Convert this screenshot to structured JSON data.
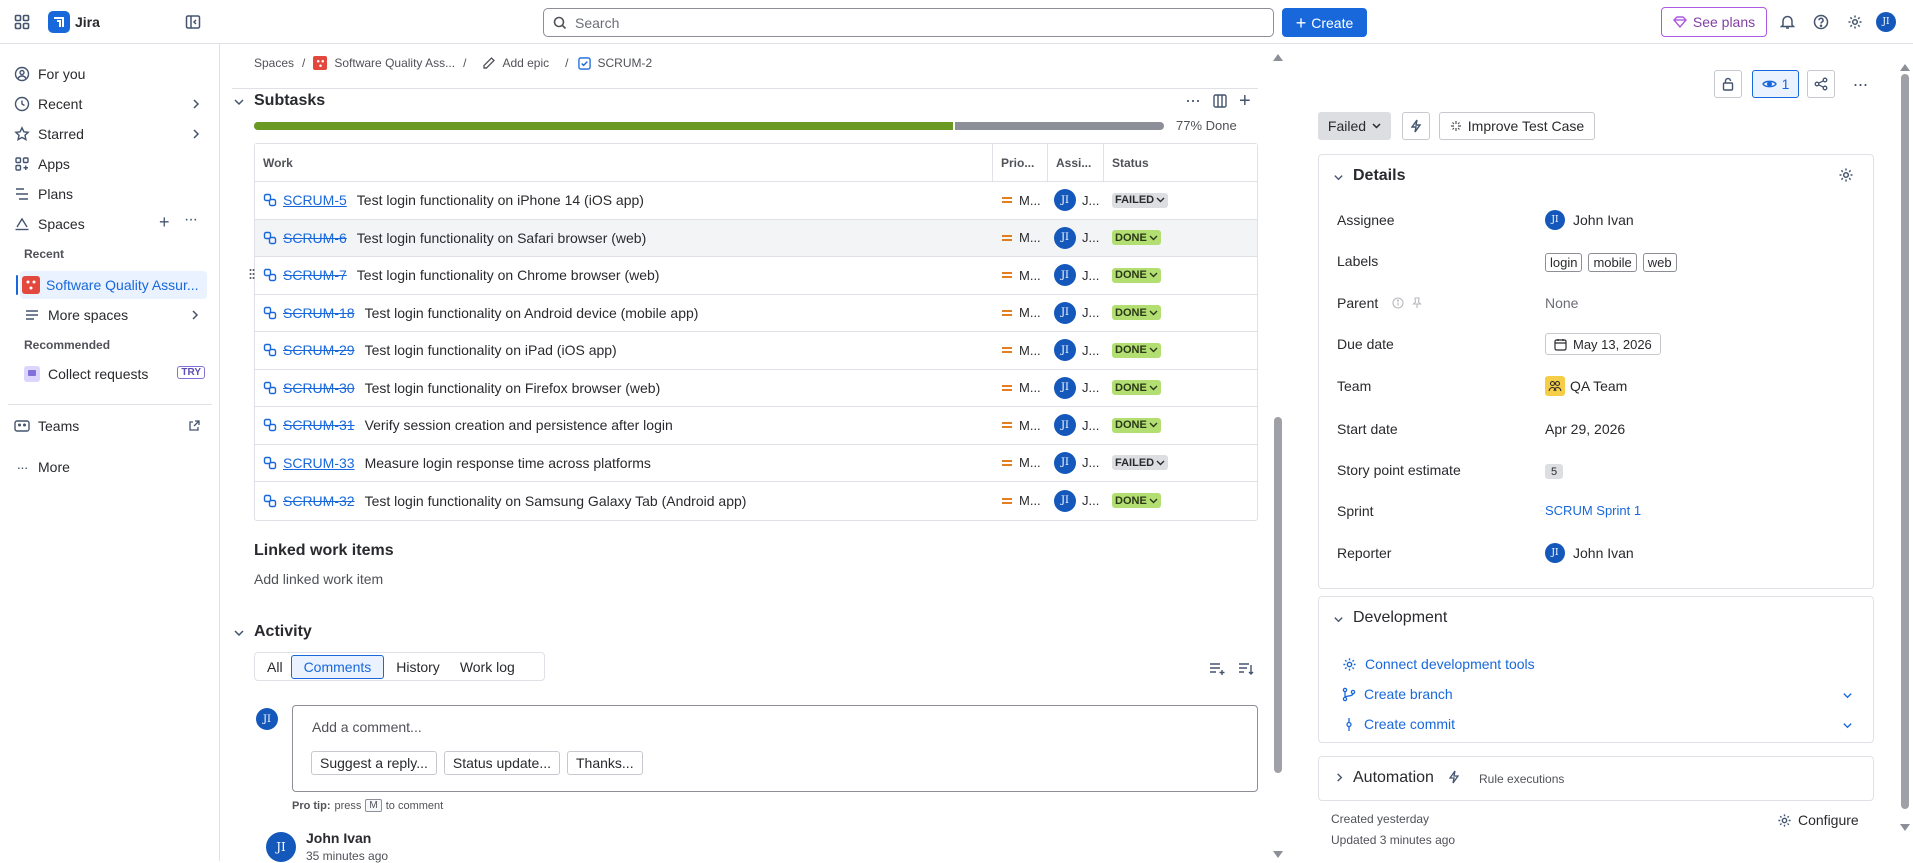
{
  "topbar": {
    "app_name": "Jira",
    "search_placeholder": "Search",
    "create_label": "Create",
    "see_plans_label": "See plans",
    "avatar_initials": "JI"
  },
  "sidebar": {
    "for_you": "For you",
    "recent": "Recent",
    "starred": "Starred",
    "apps": "Apps",
    "plans": "Plans",
    "spaces": "Spaces",
    "recent_header": "Recent",
    "active_space": "Software Quality Assur...",
    "more_spaces": "More spaces",
    "recommended_header": "Recommended",
    "collect_requests": "Collect requests",
    "try_badge": "TRY",
    "teams": "Teams",
    "more": "More"
  },
  "breadcrumb": {
    "spaces": "Spaces",
    "project": "Software Quality Ass...",
    "add_epic": "Add epic",
    "issue_key": "SCRUM-2"
  },
  "subtasks": {
    "title": "Subtasks",
    "progress_percent": 77,
    "progress_label": "77% Done",
    "columns": [
      "Work",
      "Prio...",
      "Assi...",
      "Status"
    ],
    "rows": [
      {
        "key": "SCRUM-5",
        "summary": "Test login functionality on iPhone 14 (iOS app)",
        "priority": "M...",
        "assignee": "J...",
        "status": "FAILED",
        "done": false
      },
      {
        "key": "SCRUM-6",
        "summary": "Test login functionality on Safari browser (web)",
        "priority": "M...",
        "assignee": "J...",
        "status": "DONE",
        "done": true
      },
      {
        "key": "SCRUM-7",
        "summary": "Test login functionality on Chrome browser (web)",
        "priority": "M...",
        "assignee": "J...",
        "status": "DONE",
        "done": true
      },
      {
        "key": "SCRUM-18",
        "summary": "Test login functionality on Android device (mobile app)",
        "priority": "M...",
        "assignee": "J...",
        "status": "DONE",
        "done": true
      },
      {
        "key": "SCRUM-29",
        "summary": "Test login functionality on iPad (iOS app)",
        "priority": "M...",
        "assignee": "J...",
        "status": "DONE",
        "done": true
      },
      {
        "key": "SCRUM-30",
        "summary": "Test login functionality on Firefox browser (web)",
        "priority": "M...",
        "assignee": "J...",
        "status": "DONE",
        "done": true
      },
      {
        "key": "SCRUM-31",
        "summary": "Verify session creation and persistence after login",
        "priority": "M...",
        "assignee": "J...",
        "status": "DONE",
        "done": true
      },
      {
        "key": "SCRUM-33",
        "summary": "Measure login response time across platforms",
        "priority": "M...",
        "assignee": "J...",
        "status": "FAILED",
        "done": false
      },
      {
        "key": "SCRUM-32",
        "summary": "Test login functionality on Samsung Galaxy Tab (Android app)",
        "priority": "M...",
        "assignee": "J...",
        "status": "DONE",
        "done": true
      }
    ]
  },
  "linked": {
    "title": "Linked work items",
    "add_label": "Add linked work item"
  },
  "activity": {
    "title": "Activity",
    "tabs": [
      "All",
      "Comments",
      "History",
      "Work log"
    ],
    "active_tab": "Comments",
    "comment_placeholder": "Add a comment...",
    "quick_replies": [
      "Suggest a reply...",
      "Status update...",
      "Thanks..."
    ],
    "pro_tip_prefix": "Pro tip:",
    "pro_tip_press": "press",
    "pro_tip_key": "M",
    "pro_tip_suffix": "to comment",
    "comment_author": "John Ivan",
    "comment_time": "35 minutes ago"
  },
  "right_panel": {
    "watchers_count": "1",
    "status_label": "Failed",
    "improve_label": "Improve Test Case",
    "details_title": "Details",
    "fields": {
      "assignee_label": "Assignee",
      "assignee_value": "John Ivan",
      "labels_label": "Labels",
      "labels_values": [
        "login",
        "mobile",
        "web"
      ],
      "parent_label": "Parent",
      "parent_value": "None",
      "due_date_label": "Due date",
      "due_date_value": "May 13, 2026",
      "team_label": "Team",
      "team_value": "QA Team",
      "start_date_label": "Start date",
      "start_date_value": "Apr 29, 2026",
      "story_points_label": "Story point estimate",
      "story_points_value": "5",
      "sprint_label": "Sprint",
      "sprint_value": "SCRUM Sprint 1",
      "reporter_label": "Reporter",
      "reporter_value": "John Ivan"
    },
    "development_title": "Development",
    "connect_tools": "Connect development tools",
    "create_branch": "Create branch",
    "create_commit": "Create commit",
    "automation_title": "Automation",
    "rule_executions": "Rule executions",
    "created": "Created yesterday",
    "updated": "Updated 3 minutes ago",
    "configure": "Configure"
  },
  "colors": {
    "brand_blue": "#1868db",
    "progress_done": "#6a9a23",
    "progress_rest": "#8c8f97",
    "done_lozenge": "#b3df72",
    "failed_lozenge": "#dddee1",
    "plans_purple": "#af59e1",
    "space_icon": "#e2483d"
  }
}
